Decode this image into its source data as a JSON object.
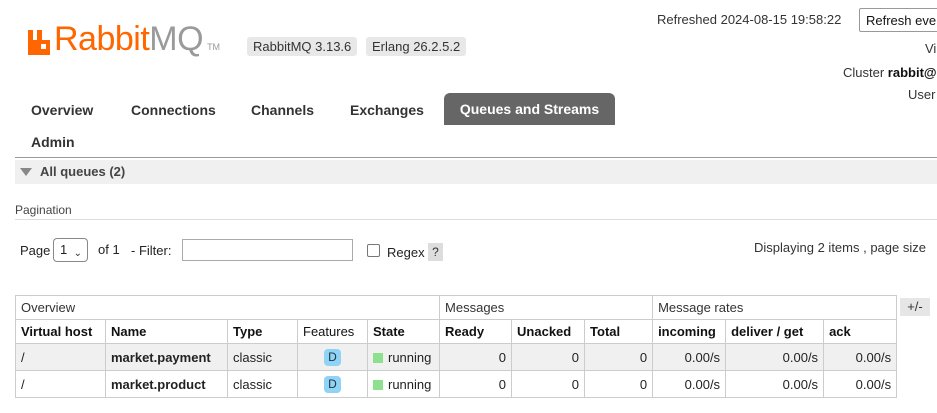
{
  "header": {
    "logo_rabbit": "Rabbit",
    "logo_mq": "MQ",
    "logo_tm": "TM",
    "rabbitmq_version": "RabbitMQ 3.13.6",
    "erlang_version": "Erlang 26.2.5.2",
    "refreshed": "Refreshed 2024-08-15 19:58:22",
    "refresh_button": "Refresh eve",
    "virtual_host_partial": "Vi",
    "cluster_label": "Cluster ",
    "cluster_name": "rabbit@",
    "user_partial": "User"
  },
  "nav": {
    "tabs": [
      {
        "label": "Overview"
      },
      {
        "label": "Connections"
      },
      {
        "label": "Channels"
      },
      {
        "label": "Exchanges"
      },
      {
        "label": "Queues and Streams"
      },
      {
        "label": "Admin"
      }
    ],
    "active": "Queues and Streams"
  },
  "section": {
    "title": "All queues (2)",
    "pagination_label": "Pagination",
    "page_label": "Page",
    "page_value": "1",
    "of_label": "of 1",
    "filter_label": "- Filter:",
    "filter_value": "",
    "regex_label": "Regex",
    "regex_checked": false,
    "help_label": "?",
    "displaying": "Displaying 2 items , page size",
    "plus_minus": "+/-"
  },
  "table": {
    "groups": [
      "Overview",
      "Messages",
      "Message rates"
    ],
    "columns": [
      "Virtual host",
      "Name",
      "Type",
      "Features",
      "State",
      "Ready",
      "Unacked",
      "Total",
      "incoming",
      "deliver / get",
      "ack"
    ],
    "rows": [
      {
        "vhost": "/",
        "name": "market.payment",
        "type": "classic",
        "feature": "D",
        "state": "running",
        "ready": "0",
        "unacked": "0",
        "total": "0",
        "incoming": "0.00/s",
        "deliver": "0.00/s",
        "ack": "0.00/s"
      },
      {
        "vhost": "/",
        "name": "market.product",
        "type": "classic",
        "feature": "D",
        "state": "running",
        "ready": "0",
        "unacked": "0",
        "total": "0",
        "incoming": "0.00/s",
        "deliver": "0.00/s",
        "ack": "0.00/s"
      }
    ]
  },
  "colors": {
    "brand_orange": "#ff6600",
    "logo_grey": "#9a9a9a",
    "active_tab": "#666666",
    "running_green": "#8de08d",
    "durable_badge": "#8fd3f5"
  }
}
